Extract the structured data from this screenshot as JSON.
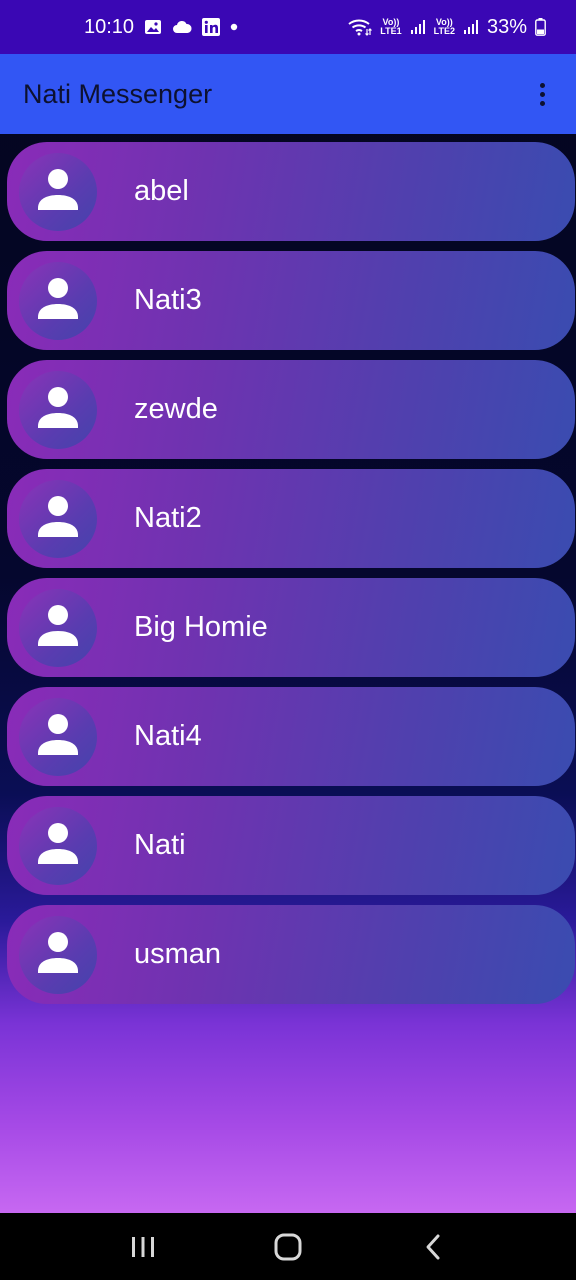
{
  "status_bar": {
    "time": "10:10",
    "left_icons": [
      "gallery-icon",
      "cloud-icon",
      "linkedin-icon",
      "dot-icon"
    ],
    "wifi_icon": "wifi-icon",
    "sim1_label_top": "Vo))",
    "sim1_label_bottom": "LTE1",
    "sim2_label_top": "Vo))",
    "sim2_label_bottom": "LTE2",
    "battery": "33%"
  },
  "app_bar": {
    "title": "Nati Messenger",
    "menu_icon": "more-vert-icon"
  },
  "contacts": [
    {
      "name": "abel"
    },
    {
      "name": "Nati3"
    },
    {
      "name": "zewde"
    },
    {
      "name": "Nati2"
    },
    {
      "name": "Big Homie"
    },
    {
      "name": "Nati4"
    },
    {
      "name": "Nati"
    },
    {
      "name": "usman"
    }
  ],
  "nav_bar": {
    "recents_icon": "recents-icon",
    "home_icon": "home-icon",
    "back_icon": "back-icon"
  },
  "colors": {
    "status_bar": "#3a07b4",
    "app_bar": "#3256f4",
    "card_start": "#8a2bb8",
    "card_end": "#3a4cb0"
  }
}
